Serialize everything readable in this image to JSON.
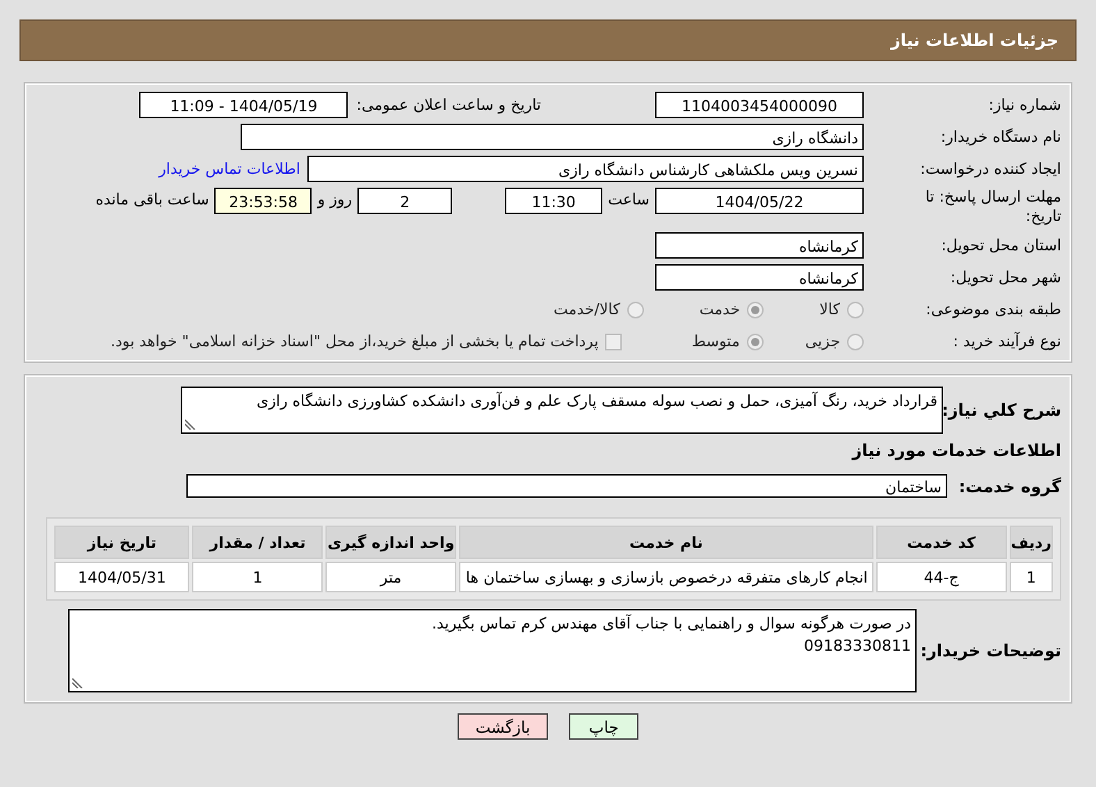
{
  "header": {
    "title": "جزئیات اطلاعات نیاز"
  },
  "info": {
    "need_number": {
      "label": "شماره نیاز:",
      "value": "1104003454000090"
    },
    "announce": {
      "label": "تاریخ و ساعت اعلان عمومی:",
      "value": "1404/05/19 - 11:09"
    },
    "buyer_org": {
      "label": "نام دستگاه خریدار:",
      "value": "دانشگاه رازی"
    },
    "creator": {
      "label": "ایجاد کننده درخواست:",
      "value": "نسرین ویس ملکشاهی کارشناس دانشگاه رازی",
      "link": "اطلاعات تماس خریدار"
    },
    "deadline": {
      "label": "مهلت ارسال پاسخ: تا تاریخ:",
      "date": "1404/05/22",
      "time_label": "ساعت",
      "time": "11:30",
      "days": "2",
      "days_label": "روز و",
      "remaining": "23:53:58",
      "remaining_label": "ساعت باقی مانده"
    },
    "province": {
      "label": "استان محل تحویل:",
      "value": "کرمانشاه"
    },
    "city": {
      "label": "شهر محل تحویل:",
      "value": "کرمانشاه"
    },
    "category": {
      "label": "طبقه بندی موضوعی:",
      "options": [
        {
          "label": "کالا",
          "selected": false
        },
        {
          "label": "خدمت",
          "selected": true
        },
        {
          "label": "کالا/خدمت",
          "selected": false
        }
      ]
    },
    "process": {
      "label": "نوع فرآیند خرید :",
      "options": [
        {
          "label": "جزیی",
          "selected": false
        },
        {
          "label": "متوسط",
          "selected": true
        }
      ],
      "payment": {
        "label": "پرداخت تمام یا بخشی از مبلغ خرید،از محل \"اسناد خزانه اسلامی\" خواهد بود.",
        "checked": false
      }
    }
  },
  "services": {
    "description": {
      "label": "شرح کلي نياز:",
      "value": "قرارداد خرید، رنگ آمیزی، حمل و نصب سوله مسقف پارک علم و فن‌آوری دانشکده کشاورزی دانشگاه رازی"
    },
    "section_title": "اطلاعات خدمات مورد نیاز",
    "group": {
      "label": "گروه خدمت:",
      "value": "ساختمان"
    },
    "table": {
      "columns": [
        "ردیف",
        "کد خدمت",
        "نام خدمت",
        "واحد اندازه گیری",
        "تعداد / مقدار",
        "تاریخ نیاز"
      ],
      "rows": [
        [
          "1",
          "ج-44",
          "انجام کارهای متفرقه درخصوص بازسازی و بهسازی ساختمان ها",
          "متر",
          "1",
          "1404/05/31"
        ]
      ]
    },
    "notes": {
      "label": "توضیحات خریدار:",
      "value": "در صورت هرگونه سوال و راهنمایی با جناب آقای مهندس کرم تماس بگیرید.\n09183330811"
    }
  },
  "buttons": [
    {
      "label": "چاپ",
      "kind": "print"
    },
    {
      "label": "بازگشت",
      "kind": "back"
    }
  ]
}
